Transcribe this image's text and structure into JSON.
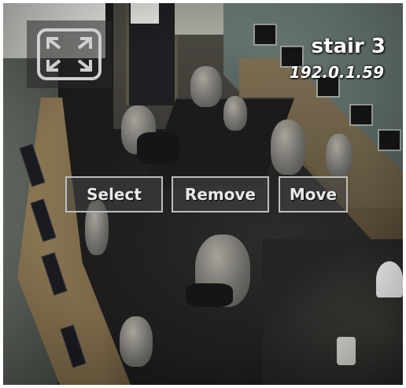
{
  "camera": {
    "name": "stair 3",
    "ip": "192.0.1.59"
  },
  "controls": {
    "expand_icon": "fullscreen-expand-icon",
    "select_label": "Select",
    "remove_label": "Remove",
    "move_label": "Move"
  },
  "colors": {
    "overlay_text": "#ffffff",
    "button_border": "#bdbdbd",
    "button_text": "#e9e9e9",
    "icon_stroke": "#cfcfcf"
  }
}
